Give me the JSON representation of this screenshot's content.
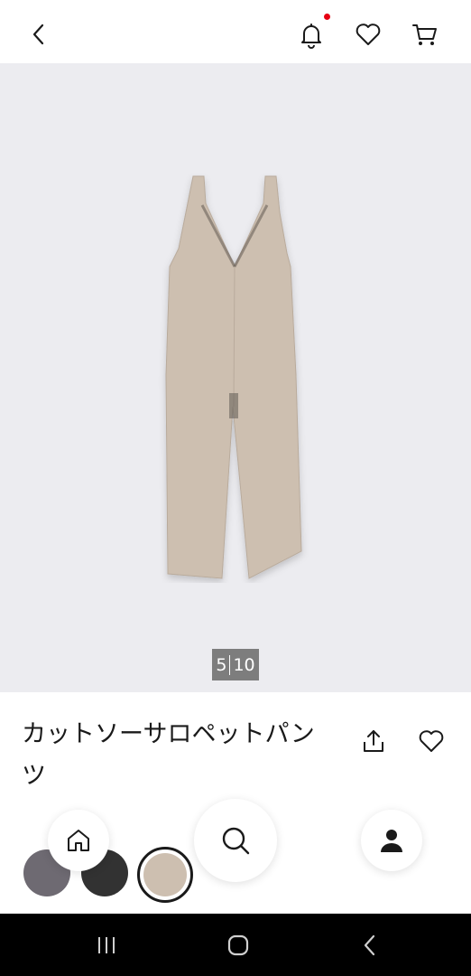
{
  "header": {
    "icons": [
      "back-icon",
      "bell-icon",
      "heart-icon",
      "cart-icon"
    ],
    "notification_dot_color": "#e60012"
  },
  "gallery": {
    "current": "5",
    "total": "10",
    "background": "#ececf0",
    "counter_background": "#7d7d7d",
    "product_color": "#cdbfb0"
  },
  "product": {
    "title": "カットソーサロペットパンツ",
    "icons": [
      "share-icon",
      "favorite-icon"
    ]
  },
  "swatches": {
    "colors": [
      "#6e6a72",
      "#323232",
      "#cdbfb0"
    ],
    "selected_index": 2
  },
  "floating_nav": {
    "icons": [
      "home-icon",
      "search-icon",
      "account-icon"
    ]
  },
  "system_nav": {
    "icons": [
      "recent-apps-icon",
      "home-circle-icon",
      "system-back-icon"
    ]
  }
}
